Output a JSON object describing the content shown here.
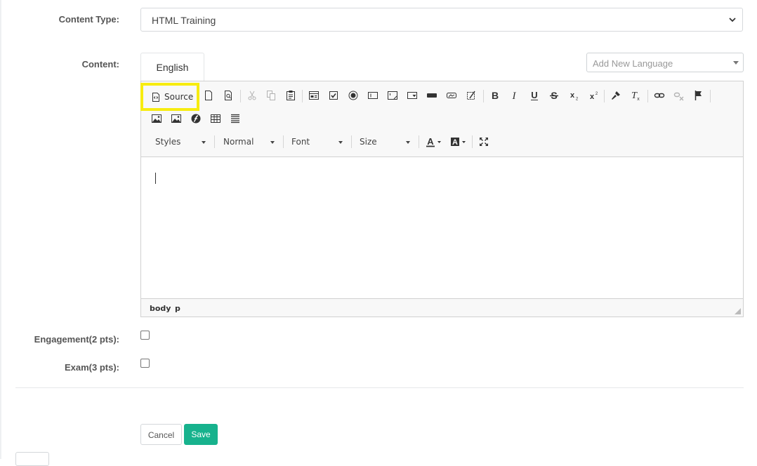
{
  "form": {
    "content_type_label": "Content Type:",
    "content_type_value": "HTML Training",
    "content_label": "Content:",
    "engagement_label": "Engagement(2 pts):",
    "exam_label": "Exam(3 pts):"
  },
  "language": {
    "tab_label": "English",
    "add_placeholder": "Add New Language"
  },
  "editor": {
    "source_label": "Source",
    "styles_label": "Styles",
    "format_label": "Normal",
    "font_label": "Font",
    "size_label": "Size",
    "path": [
      "body",
      "p"
    ],
    "highlight_color": "#f7ec10"
  },
  "actions": {
    "cancel_label": "Cancel",
    "save_label": "Save",
    "save_color": "#17b28d"
  }
}
